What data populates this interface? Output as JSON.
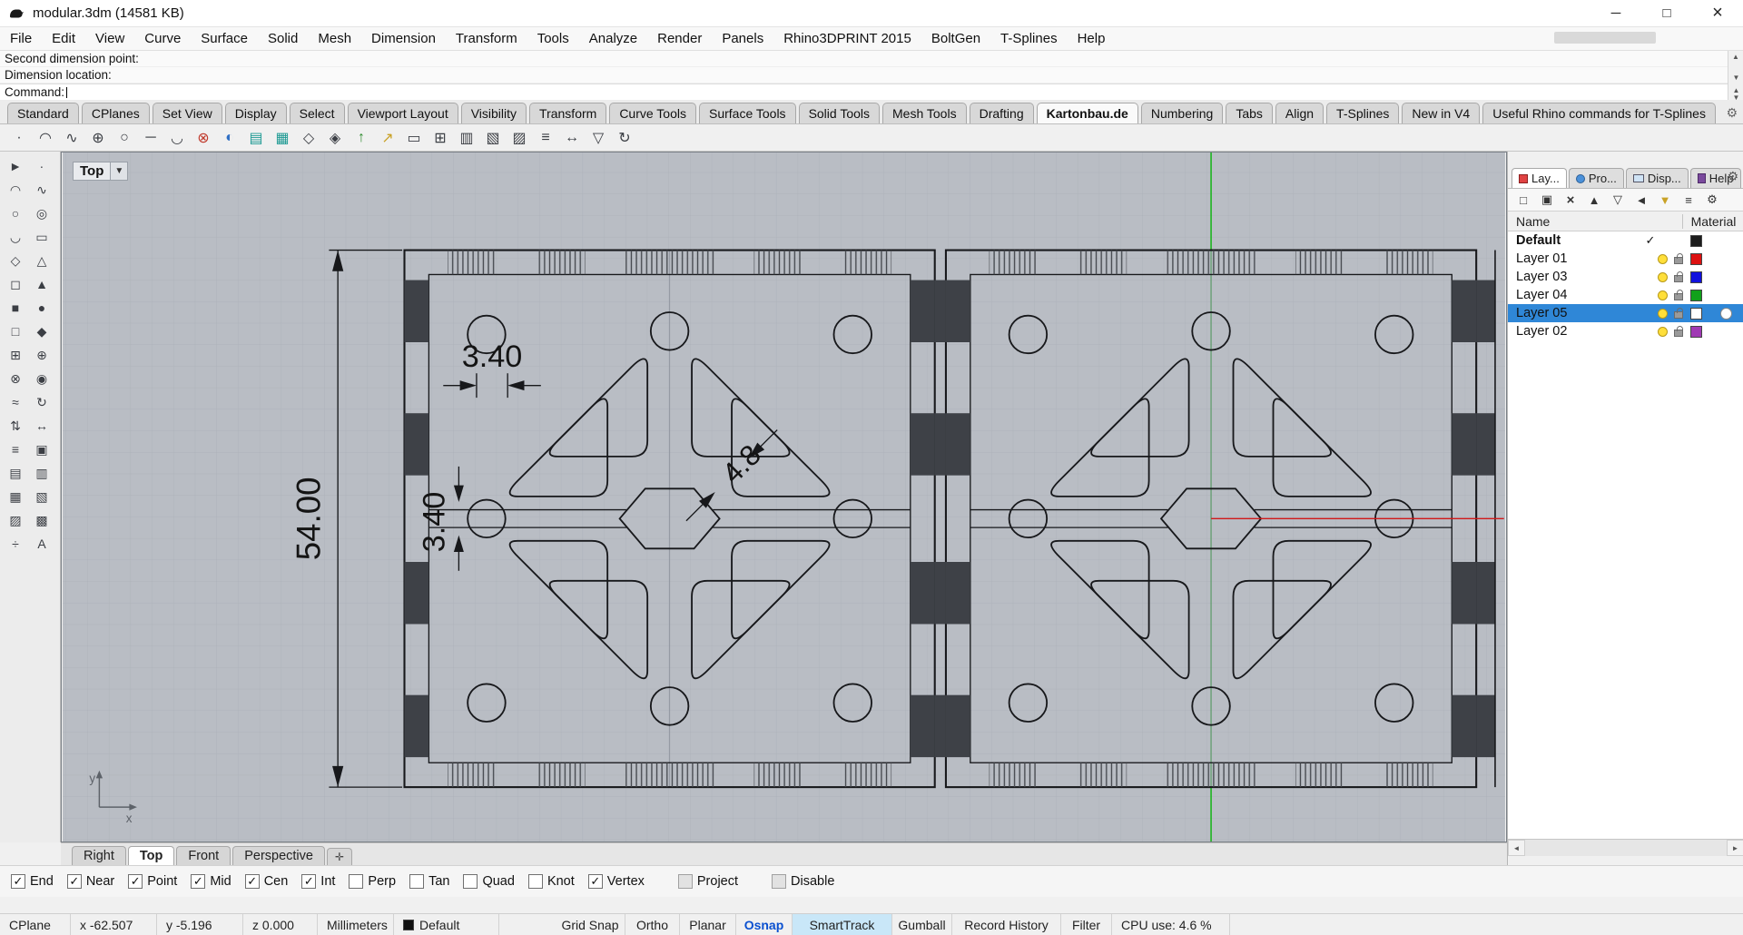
{
  "window": {
    "title": "modular.3dm (14581 KB)"
  },
  "menu": {
    "items": [
      "File",
      "Edit",
      "View",
      "Curve",
      "Surface",
      "Solid",
      "Mesh",
      "Dimension",
      "Transform",
      "Tools",
      "Analyze",
      "Render",
      "Panels",
      "Rhino3DPRINT 2015",
      "BoltGen",
      "T-Splines",
      "Help"
    ]
  },
  "command": {
    "line1": "Second dimension point:",
    "line2": "Dimension location:",
    "prompt": "Command:"
  },
  "toolbar_tabs": {
    "active": "Kartonbau.de",
    "items": [
      "Standard",
      "CPlanes",
      "Set View",
      "Display",
      "Select",
      "Viewport Layout",
      "Visibility",
      "Transform",
      "Curve Tools",
      "Surface Tools",
      "Solid Tools",
      "Mesh Tools",
      "Drafting",
      "Kartonbau.de",
      "Numbering",
      "Tabs",
      "Align",
      "T-Splines",
      "New in V4",
      "Useful Rhino commands for T-Splines"
    ]
  },
  "viewport": {
    "label": "Top",
    "axis_x": "x",
    "axis_y": "y",
    "dimensions": {
      "height": "54.00",
      "slot_width": "3.40",
      "slot_height": "3.40",
      "hex_gap": "4.8"
    }
  },
  "viewport_tabs": {
    "active": "Top",
    "items": [
      "Right",
      "Top",
      "Front",
      "Perspective"
    ]
  },
  "layers_panel": {
    "tabs": [
      {
        "label": "Lay..."
      },
      {
        "label": "Pro..."
      },
      {
        "label": "Disp..."
      },
      {
        "label": "Help"
      }
    ],
    "columns": {
      "name": "Name",
      "material": "Material"
    },
    "rows": [
      {
        "name": "Default",
        "current": true,
        "selected": false,
        "color": "#1c1c1c"
      },
      {
        "name": "Layer 01",
        "current": false,
        "selected": false,
        "color": "#dd1111"
      },
      {
        "name": "Layer 03",
        "current": false,
        "selected": false,
        "color": "#1111dd"
      },
      {
        "name": "Layer 04",
        "current": false,
        "selected": false,
        "color": "#11a11a"
      },
      {
        "name": "Layer 05",
        "current": false,
        "selected": true,
        "color": "#ffffff"
      },
      {
        "name": "Layer 02",
        "current": false,
        "selected": false,
        "color": "#a03ab4"
      }
    ]
  },
  "osnap": {
    "items": [
      {
        "label": "End",
        "checked": true,
        "muted": false
      },
      {
        "label": "Near",
        "checked": true,
        "muted": false
      },
      {
        "label": "Point",
        "checked": true,
        "muted": false
      },
      {
        "label": "Mid",
        "checked": true,
        "muted": false
      },
      {
        "label": "Cen",
        "checked": true,
        "muted": false
      },
      {
        "label": "Int",
        "checked": true,
        "muted": false
      },
      {
        "label": "Perp",
        "checked": false,
        "muted": false
      },
      {
        "label": "Tan",
        "checked": false,
        "muted": false
      },
      {
        "label": "Quad",
        "checked": false,
        "muted": false
      },
      {
        "label": "Knot",
        "checked": false,
        "muted": false
      },
      {
        "label": "Vertex",
        "checked": true,
        "muted": false
      },
      {
        "label": "Project",
        "checked": false,
        "muted": true
      },
      {
        "label": "Disable",
        "checked": false,
        "muted": true
      }
    ]
  },
  "statusbar": {
    "cplane": "CPlane",
    "x": "x -62.507",
    "y": "y -5.196",
    "z": "z 0.000",
    "units": "Millimeters",
    "layer": "Default",
    "toggles": [
      "Grid Snap",
      "Ortho",
      "Planar",
      "Osnap",
      "SmartTrack",
      "Gumball",
      "Record History",
      "Filter"
    ],
    "cpu": "CPU use: 4.6 %"
  },
  "colors": {
    "selection": "#2f87d7",
    "viewport_bg": "#b9bdc4",
    "axis_green": "#00b400",
    "axis_red": "#d01818"
  }
}
